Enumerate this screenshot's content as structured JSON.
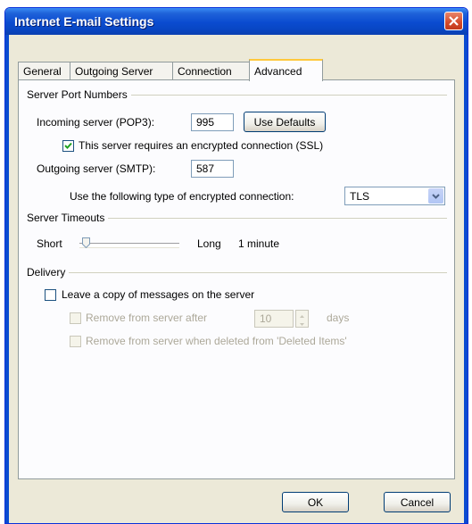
{
  "window": {
    "title": "Internet E-mail Settings"
  },
  "tabs": [
    "General",
    "Outgoing Server",
    "Connection",
    "Advanced"
  ],
  "server_ports": {
    "group_label": "Server Port Numbers",
    "incoming_label": "Incoming server (POP3):",
    "incoming_value": "995",
    "use_defaults_label": "Use Defaults",
    "ssl_label": "This server requires an encrypted connection (SSL)",
    "ssl_checked": true,
    "outgoing_label": "Outgoing server (SMTP):",
    "outgoing_value": "587",
    "encryption_label": "Use the following type of encrypted connection:",
    "encryption_value": "TLS"
  },
  "server_timeouts": {
    "group_label": "Server Timeouts",
    "short_label": "Short",
    "long_label": "Long",
    "value_label": "1 minute"
  },
  "delivery": {
    "group_label": "Delivery",
    "leave_copy_label": "Leave a copy of messages on the server",
    "remove_after_label": "Remove from server after",
    "remove_after_days": "10",
    "days_label": "days",
    "remove_deleted_label": "Remove from server when deleted from 'Deleted Items'"
  },
  "buttons": {
    "ok": "OK",
    "cancel": "Cancel"
  }
}
